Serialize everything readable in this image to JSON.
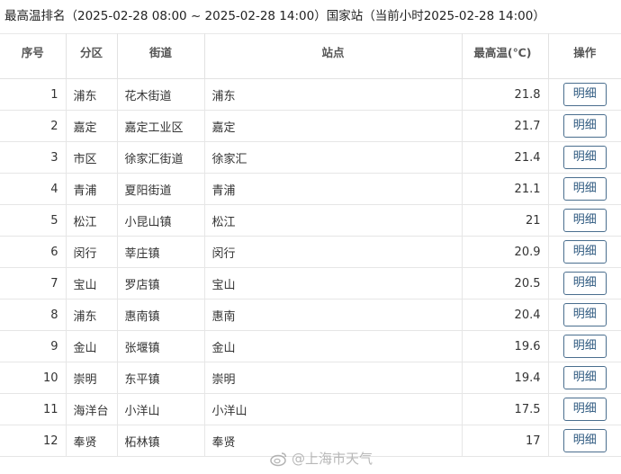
{
  "page_title": "最高温排名（2025-02-28 08:00 ~ 2025-02-28 14:00）国家站（当前小时2025-02-28 14:00）",
  "columns": {
    "index": "序号",
    "district": "分区",
    "street": "街道",
    "station": "站点",
    "max_temp": "最高温(℃)",
    "action": "操作"
  },
  "detail_label": "明细",
  "rows": [
    {
      "index": "1",
      "district": "浦东",
      "street": "花木街道",
      "station": "浦东",
      "max_temp": "21.8"
    },
    {
      "index": "2",
      "district": "嘉定",
      "street": "嘉定工业区",
      "station": "嘉定",
      "max_temp": "21.7"
    },
    {
      "index": "3",
      "district": "市区",
      "street": "徐家汇街道",
      "station": "徐家汇",
      "max_temp": "21.4"
    },
    {
      "index": "4",
      "district": "青浦",
      "street": "夏阳街道",
      "station": "青浦",
      "max_temp": "21.1"
    },
    {
      "index": "5",
      "district": "松江",
      "street": "小昆山镇",
      "station": "松江",
      "max_temp": "21"
    },
    {
      "index": "6",
      "district": "闵行",
      "street": "莘庄镇",
      "station": "闵行",
      "max_temp": "20.9"
    },
    {
      "index": "7",
      "district": "宝山",
      "street": "罗店镇",
      "station": "宝山",
      "max_temp": "20.5"
    },
    {
      "index": "8",
      "district": "浦东",
      "street": "惠南镇",
      "station": "惠南",
      "max_temp": "20.4"
    },
    {
      "index": "9",
      "district": "金山",
      "street": "张堰镇",
      "station": "金山",
      "max_temp": "19.6"
    },
    {
      "index": "10",
      "district": "崇明",
      "street": "东平镇",
      "station": "崇明",
      "max_temp": "19.4"
    },
    {
      "index": "11",
      "district": "海洋台",
      "street": "小洋山",
      "station": "小洋山",
      "max_temp": "17.5"
    },
    {
      "index": "12",
      "district": "奉贤",
      "street": "柘林镇",
      "station": "奉贤",
      "max_temp": "17"
    }
  ],
  "watermark": "@上海市天气",
  "watermark_icon": "weibo-icon"
}
